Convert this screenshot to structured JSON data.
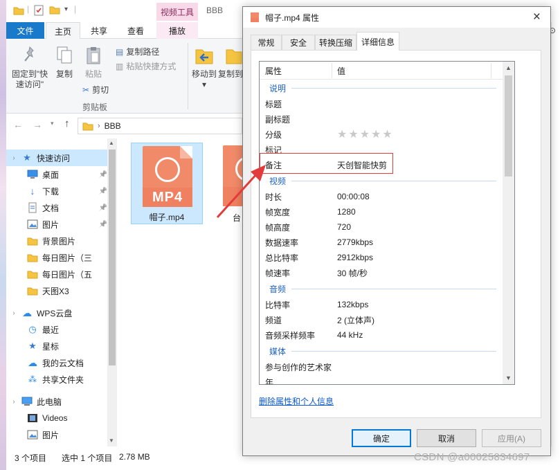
{
  "explorer": {
    "title": "BBB",
    "context_tab_group": "视频工具",
    "tabs": [
      "文件",
      "主页",
      "共享",
      "查看",
      "播放"
    ],
    "ribbon": {
      "pin_label": "固定到\"快速访问\"",
      "copy_label": "复制",
      "paste_label": "粘贴",
      "copy_path": "复制路径",
      "paste_shortcut": "粘贴快捷方式",
      "cut": "剪切",
      "clipboard_group": "剪贴板",
      "move_to": "移动到",
      "copy_to": "复制到"
    },
    "address": {
      "path": "BBB"
    },
    "sidebar": [
      {
        "label": "快速访问",
        "icon": "star-icon",
        "selected": true,
        "pinned": false,
        "indent": 0
      },
      {
        "label": "桌面",
        "icon": "desktop-icon",
        "selected": false,
        "pinned": true,
        "indent": 1
      },
      {
        "label": "下载",
        "icon": "download-icon",
        "selected": false,
        "pinned": true,
        "indent": 1
      },
      {
        "label": "文档",
        "icon": "document-icon",
        "selected": false,
        "pinned": true,
        "indent": 1
      },
      {
        "label": "图片",
        "icon": "picture-icon",
        "selected": false,
        "pinned": true,
        "indent": 1
      },
      {
        "label": "背景图片",
        "icon": "folder-icon",
        "selected": false,
        "pinned": false,
        "indent": 1
      },
      {
        "label": "每日图片（三",
        "icon": "folder-icon",
        "selected": false,
        "pinned": false,
        "indent": 1
      },
      {
        "label": "每日图片（五",
        "icon": "folder-icon",
        "selected": false,
        "pinned": false,
        "indent": 1
      },
      {
        "label": "天图X3",
        "icon": "folder-icon",
        "selected": false,
        "pinned": false,
        "indent": 1
      },
      {
        "label": "WPS云盘",
        "icon": "cloud-icon",
        "selected": false,
        "pinned": false,
        "indent": 0
      },
      {
        "label": "最近",
        "icon": "clock-icon",
        "selected": false,
        "pinned": false,
        "indent": 1
      },
      {
        "label": "星标",
        "icon": "star-icon",
        "selected": false,
        "pinned": false,
        "indent": 1
      },
      {
        "label": "我的云文档",
        "icon": "cloud-icon",
        "selected": false,
        "pinned": false,
        "indent": 1
      },
      {
        "label": "共享文件夹",
        "icon": "share-icon",
        "selected": false,
        "pinned": false,
        "indent": 1
      },
      {
        "label": "此电脑",
        "icon": "computer-icon",
        "selected": false,
        "pinned": false,
        "indent": 0
      },
      {
        "label": "Videos",
        "icon": "video-icon",
        "selected": false,
        "pinned": false,
        "indent": 1
      },
      {
        "label": "图片",
        "icon": "picture-icon",
        "selected": false,
        "pinned": false,
        "indent": 1
      }
    ],
    "files": [
      {
        "name": "帽子.mp4",
        "badge": "MP4",
        "selected": true
      },
      {
        "name": "台",
        "badge": "M",
        "selected": false
      }
    ],
    "status": {
      "count": "3 个项目",
      "selected": "选中 1 个项目",
      "size": "2.78 MB"
    }
  },
  "dialog": {
    "title": "帽子.mp4 属性",
    "close": "×",
    "tabs": [
      "常规",
      "安全",
      "转换压缩",
      "详细信息"
    ],
    "active_tab": "详细信息",
    "columns": [
      "属性",
      "值"
    ],
    "groups": [
      {
        "name": "说明",
        "rows": [
          {
            "key": "标题",
            "value": ""
          },
          {
            "key": "副标题",
            "value": ""
          },
          {
            "key": "分级",
            "value": ""
          },
          {
            "key": "标记",
            "value": ""
          },
          {
            "key": "备注",
            "value": "天创智能快剪"
          }
        ]
      },
      {
        "name": "视频",
        "rows": [
          {
            "key": "时长",
            "value": "00:00:08"
          },
          {
            "key": "帧宽度",
            "value": "1280"
          },
          {
            "key": "帧高度",
            "value": "720"
          },
          {
            "key": "数据速率",
            "value": "2779kbps"
          },
          {
            "key": "总比特率",
            "value": "2912kbps"
          },
          {
            "key": "帧速率",
            "value": "30 帧/秒"
          }
        ]
      },
      {
        "name": "音频",
        "rows": [
          {
            "key": "比特率",
            "value": "132kbps"
          },
          {
            "key": "频道",
            "value": "2 (立体声)"
          },
          {
            "key": "音频采样频率",
            "value": "44 kHz"
          }
        ]
      },
      {
        "name": "媒体",
        "rows": [
          {
            "key": "参与创作的艺术家",
            "value": ""
          },
          {
            "key": "年",
            "value": ""
          }
        ]
      }
    ],
    "rating": {
      "stars": 5,
      "filled": 0
    },
    "remove_link": "删除属性和个人信息",
    "buttons": {
      "ok": "确定",
      "cancel": "取消",
      "apply": "应用(A)"
    }
  },
  "watermark": "CSDN @a00025834697",
  "colors": {
    "accent": "#1979ca",
    "highlight": "#e23b3b",
    "group": "#1e62c0",
    "selection": "#cce8ff"
  }
}
